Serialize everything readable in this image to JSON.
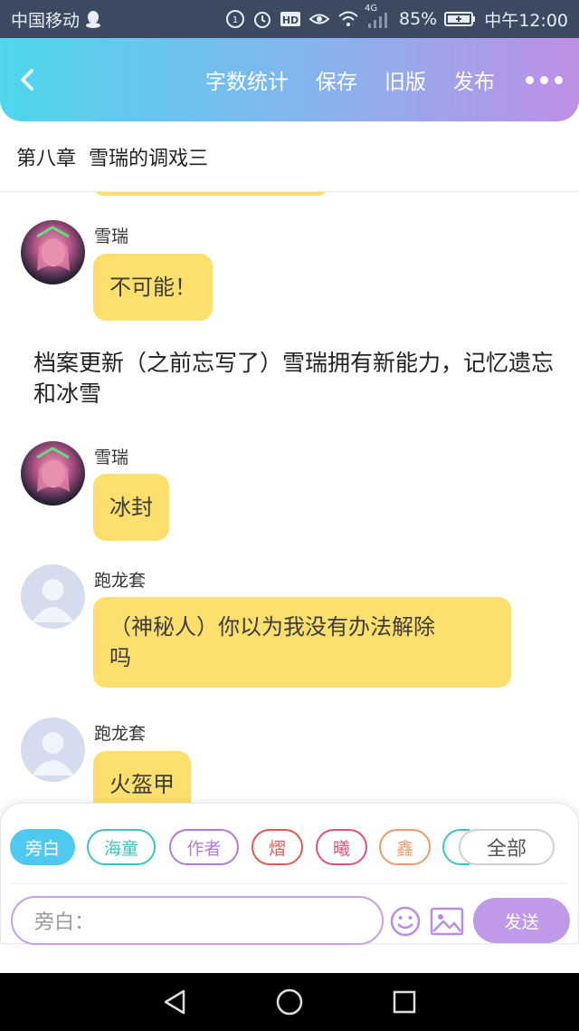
{
  "status_bar": {
    "carrier": "中国移动",
    "signal_label": "4G",
    "battery": "85%",
    "time": "中午12:00"
  },
  "header": {
    "actions": [
      "字数统计",
      "保存",
      "旧版",
      "发布"
    ]
  },
  "chapter": {
    "title": "第八章  雪瑞的调戏三"
  },
  "messages": [
    {
      "name": "雪瑞",
      "text": "不可能！"
    },
    {
      "narration": "档案更新（之前忘写了）雪瑞拥有新能力，记忆遗忘和冰雪"
    },
    {
      "name": "雪瑞",
      "text": "冰封"
    },
    {
      "name": "跑龙套",
      "text_line1": "（神秘人）你以为我没有办法解除",
      "text_line2": "吗"
    },
    {
      "name": "跑龙套",
      "text": "火盔甲"
    }
  ],
  "roles": [
    {
      "label": "旁白",
      "color": "#4fc9f0",
      "active": true
    },
    {
      "label": "海童",
      "color": "#3cc4c0"
    },
    {
      "label": "作者",
      "color": "#b57ad8"
    },
    {
      "label": "熠",
      "color": "#e05a4f"
    },
    {
      "label": "曦",
      "color": "#e0527a"
    },
    {
      "label": "鑫",
      "color": "#f09a6a"
    },
    {
      "label": "全部",
      "color": "#cccccc"
    }
  ],
  "composer": {
    "placeholder": "旁白：",
    "send_label": "发送"
  }
}
